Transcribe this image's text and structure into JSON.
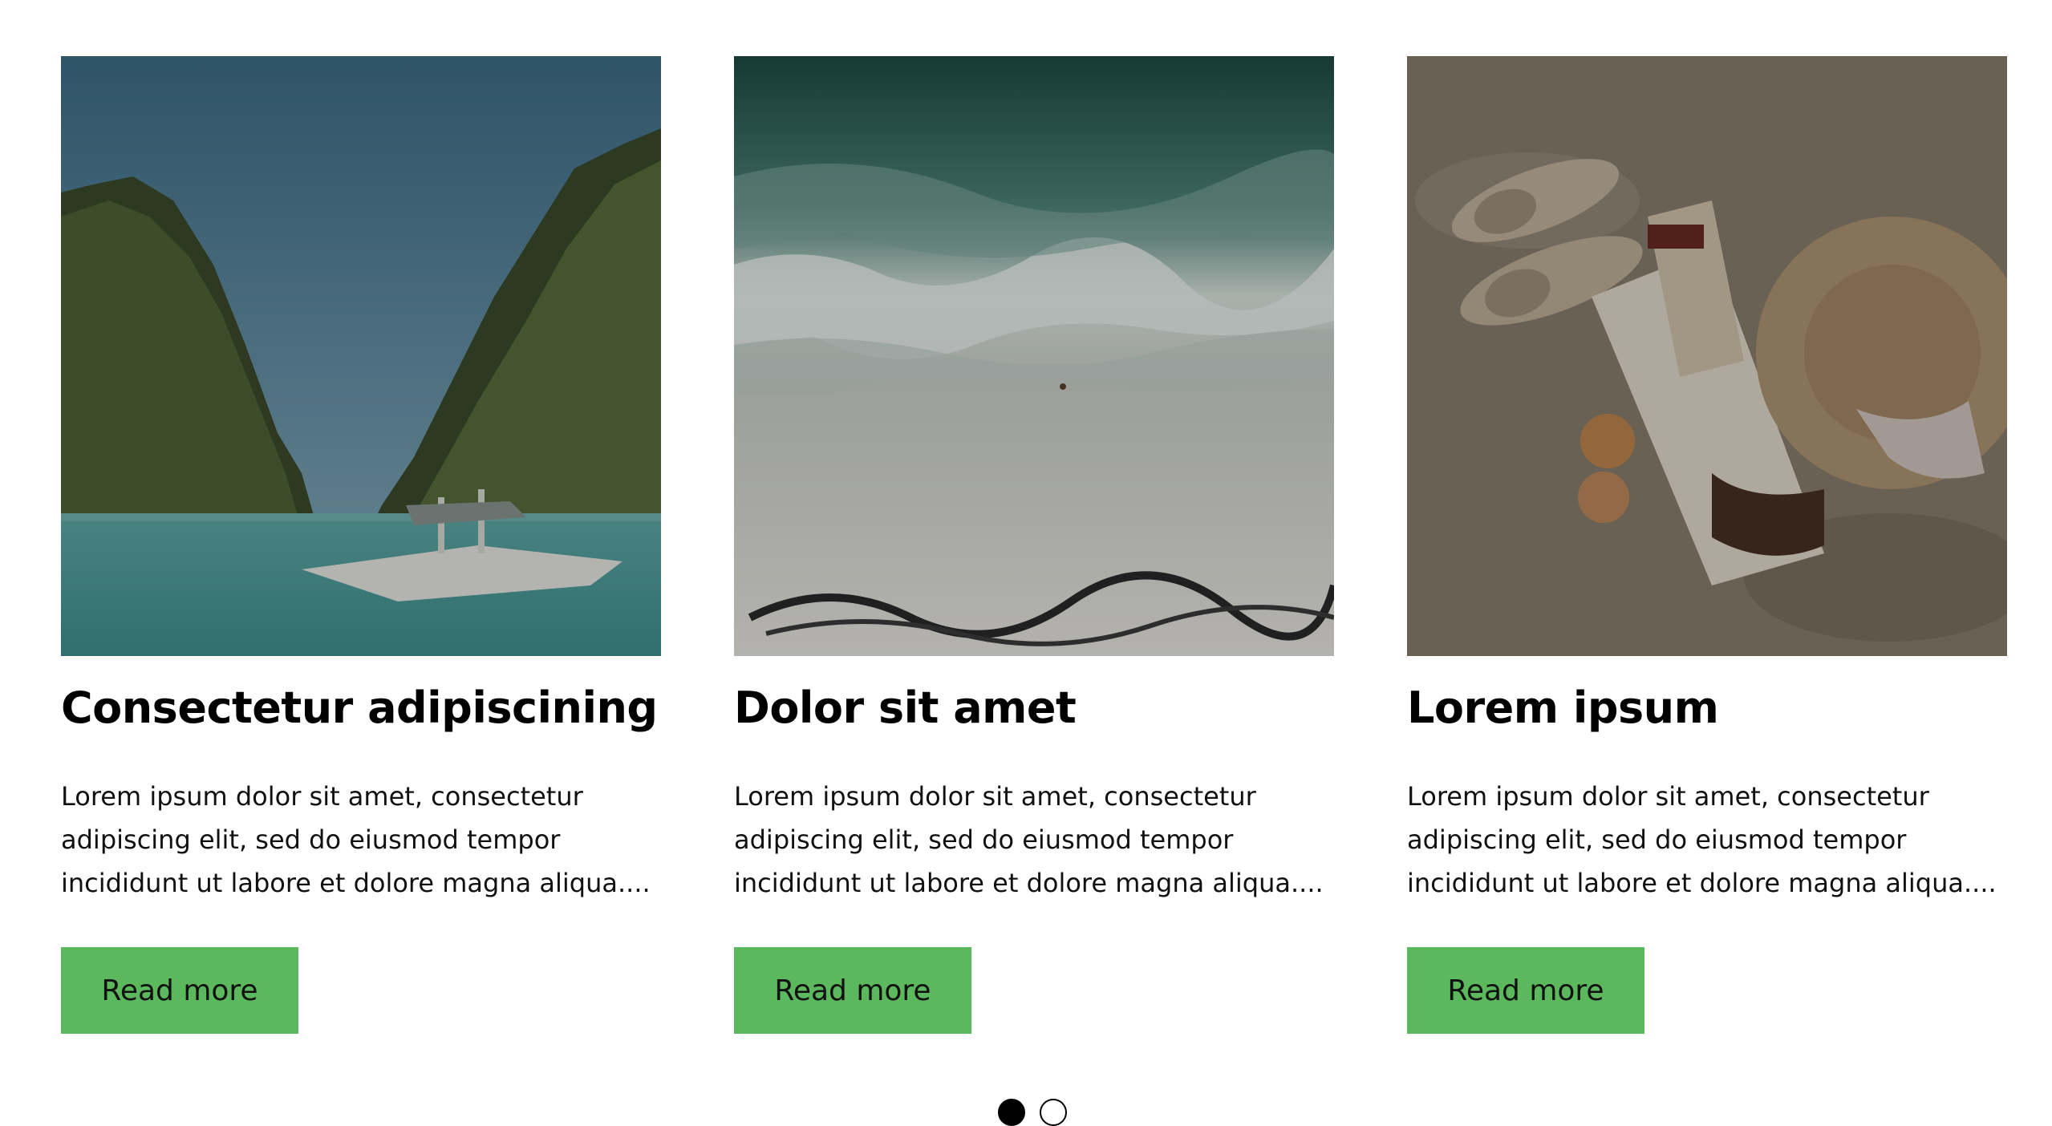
{
  "cards": [
    {
      "image_alt": "Boat in lagoon between limestone cliffs",
      "title": "Consectetur adipiscining",
      "excerpt_lines": [
        "Lorem ipsum dolor sit amet, consectetur",
        "adipiscing elit, sed do eiusmod tempor",
        "incididunt ut labore et dolore magna aliqua...."
      ],
      "button_label": "Read more"
    },
    {
      "image_alt": "Aerial view of waves on a beach",
      "title": "Dolor sit amet",
      "excerpt_lines": [
        "Lorem ipsum dolor sit amet, consectetur",
        "adipiscing elit, sed do eiusmod tempor",
        "incididunt ut labore et dolore magna aliqua...."
      ],
      "button_label": "Read more"
    },
    {
      "image_alt": "Sandals, straw hat, book and bag on sand",
      "title": "Lorem ipsum",
      "excerpt_lines": [
        "Lorem ipsum dolor sit amet, consectetur",
        "adipiscing elit, sed do eiusmod tempor",
        "incididunt ut labore et dolore magna aliqua...."
      ],
      "button_label": "Read more"
    }
  ],
  "pagination": {
    "active_index": 0,
    "count": 2
  },
  "colors": {
    "button": "#5cb85c",
    "text": "#000000"
  }
}
